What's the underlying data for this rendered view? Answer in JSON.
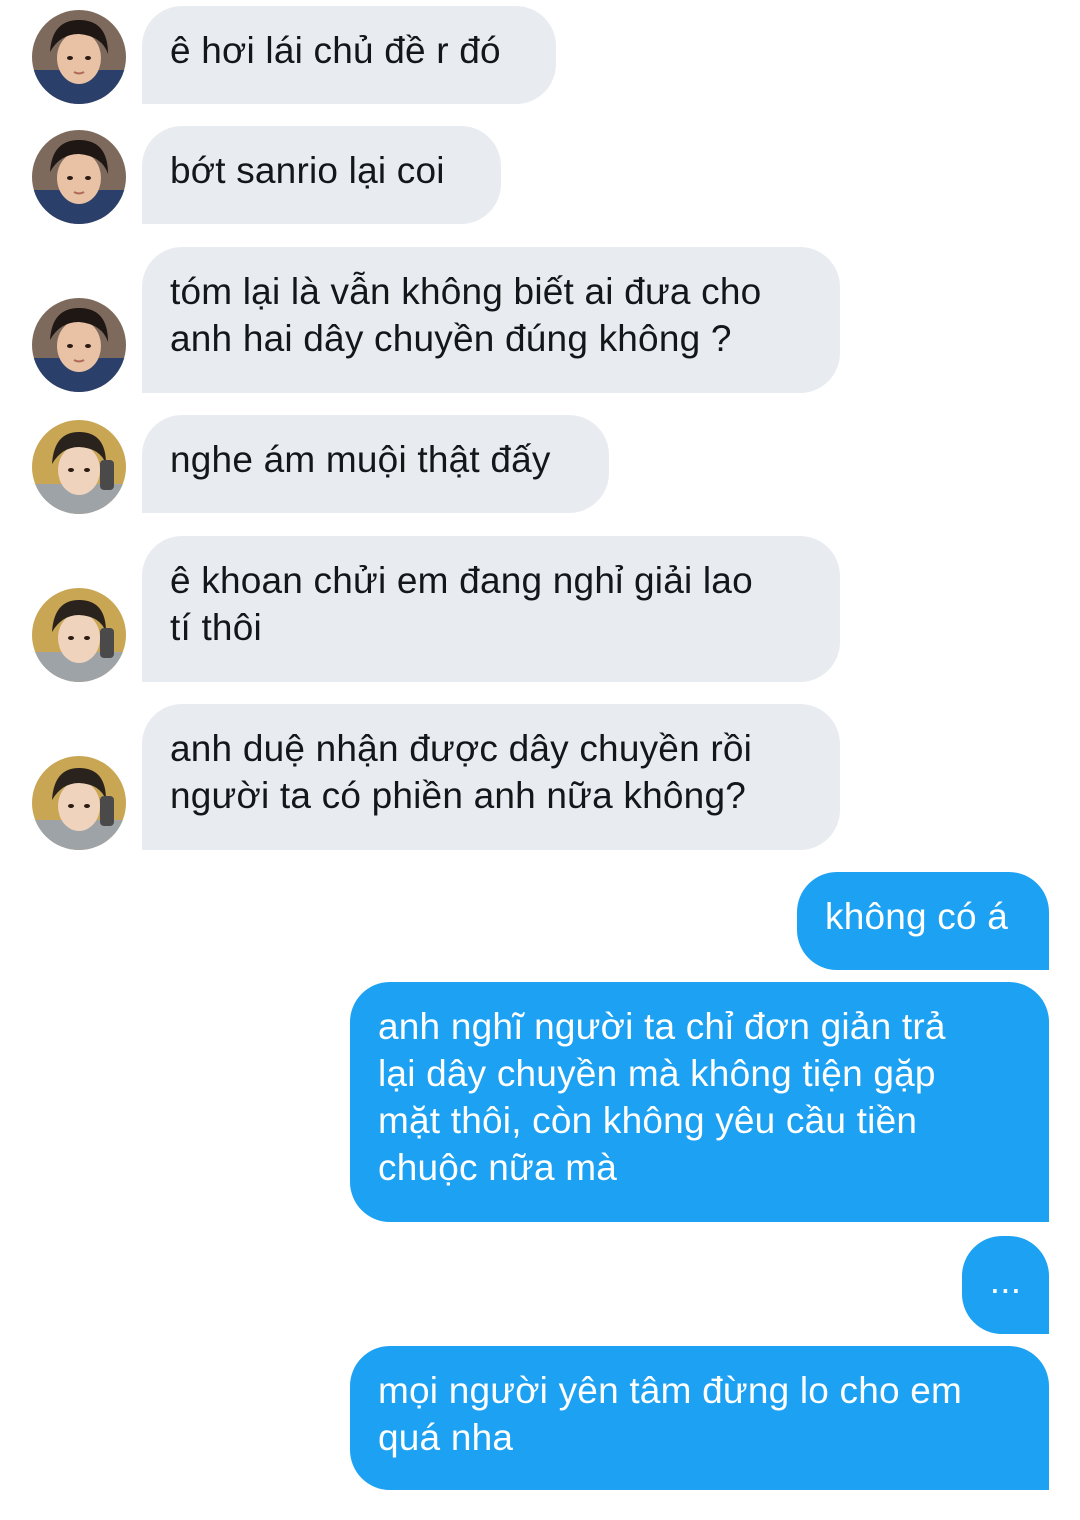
{
  "conversation": {
    "messages": [
      {
        "sender": "user-a",
        "text": "ê hơi lái chủ đề r đó"
      },
      {
        "sender": "user-a",
        "text": "bớt sanrio lại coi"
      },
      {
        "sender": "user-a",
        "text": "tóm lại là vẫn không biết ai đưa cho\nanh hai dây chuyền đúng không ?"
      },
      {
        "sender": "user-b",
        "text": "nghe ám muội thật đấy"
      },
      {
        "sender": "user-b",
        "text": "ê khoan chửi em đang nghỉ giải lao\ntí thôi"
      },
      {
        "sender": "user-b",
        "text": "anh duệ nhận được dây chuyền rồi\nngười ta có phiền anh nữa không?"
      },
      {
        "sender": "me",
        "text": "không có á"
      },
      {
        "sender": "me",
        "text": "anh nghĩ người ta chỉ đơn giản trả\nlại dây chuyền mà không tiện gặp\nmặt thôi, còn không yêu cầu tiền\nchuộc nữa mà"
      },
      {
        "sender": "me",
        "text": "..."
      },
      {
        "sender": "me",
        "text": "mọi người yên tâm đừng lo cho em\nquá nha"
      }
    ]
  },
  "colors": {
    "incoming_bubble": "#e8ecf0",
    "incoming_text": "#14171a",
    "outgoing_bubble": "#1da1f2",
    "outgoing_text": "#ffffff"
  },
  "icons": {
    "user_a_avatar": "profile-photo-dark-hair-blue-jacket",
    "user_b_avatar": "profile-photo-dark-hair-gray-hoodie"
  }
}
